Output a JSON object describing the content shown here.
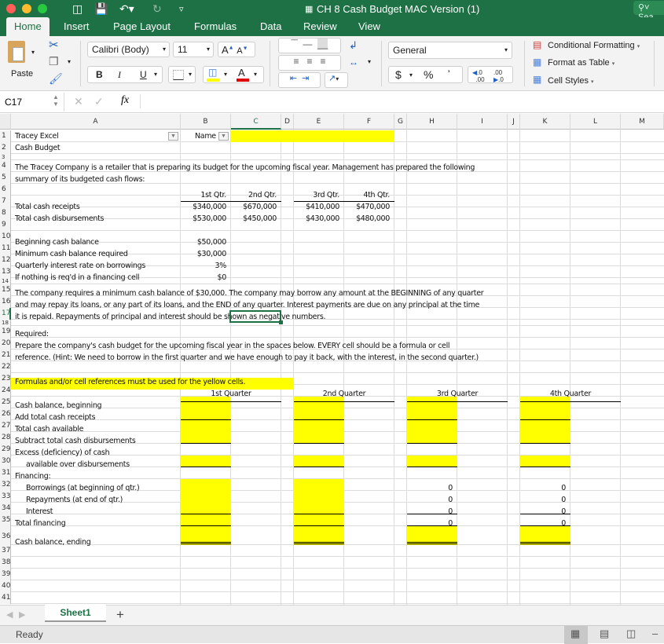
{
  "window": {
    "title": "CH 8 Cash Budget MAC Version (1)",
    "search_placeholder": "Sea",
    "colors": {
      "brand": "#1e7145",
      "highlight": "#ffff00",
      "fill_icon": "#ffff00",
      "font_icon": "#e00000",
      "active_sheet": "#1e7145"
    }
  },
  "ribbon_tabs": [
    "Home",
    "Insert",
    "Page Layout",
    "Formulas",
    "Data",
    "Review",
    "View"
  ],
  "ribbon": {
    "paste_label": "Paste",
    "font_name": "Calibri (Body)",
    "font_size": "11",
    "bold": "B",
    "italic": "I",
    "underline": "U",
    "number_format": "General",
    "currency": "$",
    "percent": "%",
    "comma": "ʾ",
    "conditional_formatting": "Conditional Formatting",
    "format_as_table": "Format as Table",
    "cell_styles": "Cell Styles"
  },
  "formula_bar": {
    "name_box": "C17",
    "fx": "fx",
    "value": ""
  },
  "columns": [
    "A",
    "B",
    "C",
    "D",
    "E",
    "F",
    "G",
    "H",
    "I",
    "J",
    "K",
    "L",
    "M"
  ],
  "rows": [
    "1",
    "2",
    "3",
    "4",
    "5",
    "6",
    "7",
    "8",
    "9",
    "10",
    "11",
    "12",
    "13",
    "14",
    "15",
    "16",
    "17",
    "18",
    "19",
    "20",
    "21",
    "22",
    "23",
    "24",
    "25",
    "26",
    "27",
    "28",
    "29",
    "30",
    "31",
    "32",
    "33",
    "34",
    "35",
    "36",
    "37",
    "38",
    "39",
    "40",
    "41"
  ],
  "sheet": {
    "a1": "Tracey Excel",
    "b1": "Name",
    "a2": "Cash Budget",
    "a4": "The Tracey Company is a retailer that is preparing its budget for the upcoming fiscal year. Management has prepared the following",
    "a5": "summary of its budgeted cash flows:",
    "quarters_short": [
      "1st Qtr.",
      "2nd Qtr.",
      "3rd Qtr.",
      "4th Qtr."
    ],
    "a7": "Total cash receipts",
    "receipts": [
      "$340,000",
      "$670,000",
      "$410,000",
      "$470,000"
    ],
    "a8": "Total cash disbursements",
    "disbursements": [
      "$530,000",
      "$450,000",
      "$430,000",
      "$480,000"
    ],
    "a10": "Beginning cash balance",
    "b10": "$50,000",
    "a11": "Minimum cash balance required",
    "b11": "$30,000",
    "a12": "Quarterly interest rate on borrowings",
    "b12": "3%",
    "a13": "If nothing is req'd in a financing cell",
    "b13": "$0",
    "a15": "The company requires a minimum cash balance of $30,000. The company may borrow any amount at the BEGINNING of any quarter",
    "a16": "and may repay its loans, or any part of its loans, and the END of any quarter. Interest payments are due on any principal at the time",
    "a17": "it is repaid. Repayments of principal and interest should be shown as negative numbers.",
    "a19": "Required:",
    "a20": "Prepare the company's cash budget for the upcoming fiscal year in the spaces below. EVERY cell should be a formula or cell",
    "a21": "reference. (Hint: We need to borrow in the first quarter and we have enough to pay it back, with the interest, in the second quarter.)",
    "a23": "Formulas and/or cell references must be used for the yellow cells.",
    "quarters_long": [
      "1st Quarter",
      "2nd Quarter",
      "3rd Quarter",
      "4th Quarter"
    ],
    "labels": {
      "r25": "Cash balance, beginning",
      "r26": "Add total cash receipts",
      "r27": "Total cash available",
      "r28": "Subtract total cash disbursements",
      "r29": "Excess (deficiency) of cash",
      "r30": "available over disbursements",
      "r31": "Financing:",
      "r32": "Borrowings (at beginning of qtr.)",
      "r33": "Repayments (at end of qtr.)",
      "r34": "Interest",
      "r35": "Total financing",
      "r36": "Cash balance, ending"
    },
    "q3_financing": [
      "0",
      "0",
      "0",
      "0"
    ],
    "q4_financing": [
      "0",
      "0",
      "0",
      "0"
    ]
  },
  "sheet_tabs": {
    "active": "Sheet1",
    "add": "+"
  },
  "status": {
    "text": "Ready"
  }
}
